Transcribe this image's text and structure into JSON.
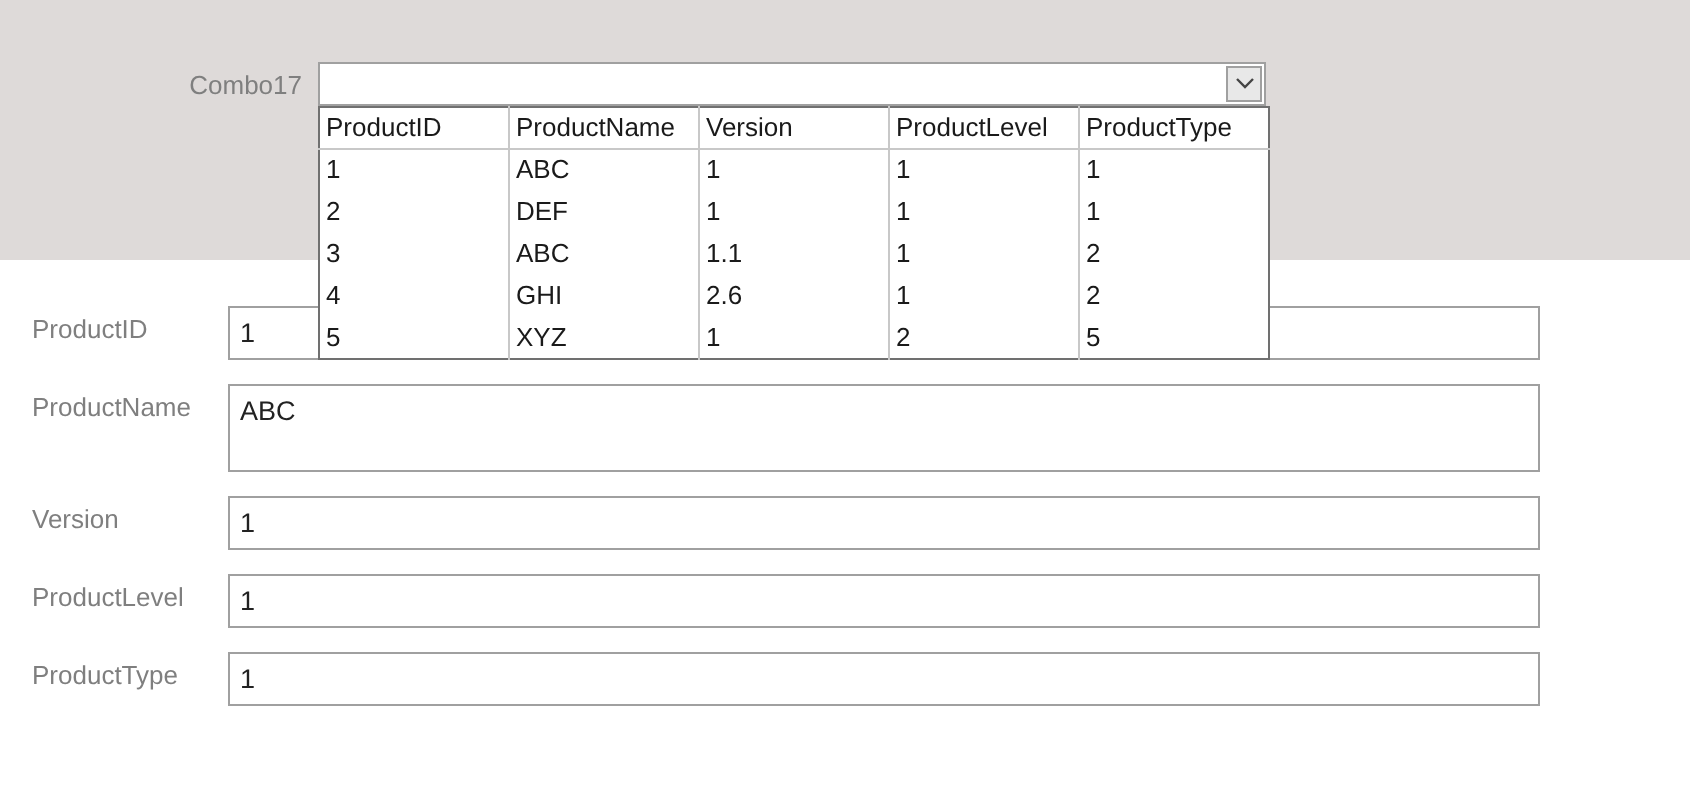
{
  "header": {
    "combo": {
      "label": "Combo17",
      "dropdown": {
        "columns": [
          "ProductID",
          "ProductName",
          "Version",
          "ProductLevel",
          "ProductType"
        ],
        "rows": [
          [
            "1",
            "ABC",
            "1",
            "1",
            "1"
          ],
          [
            "2",
            "DEF",
            "1",
            "1",
            "1"
          ],
          [
            "3",
            "ABC",
            "1.1",
            "1",
            "2"
          ],
          [
            "4",
            "GHI",
            "2.6",
            "1",
            "2"
          ],
          [
            "5",
            "XYZ",
            "1",
            "2",
            "5"
          ]
        ]
      }
    }
  },
  "fields": [
    {
      "label": "ProductID",
      "value": "1",
      "kind": "text"
    },
    {
      "label": "ProductName",
      "value": "ABC",
      "kind": "memo"
    },
    {
      "label": "Version",
      "value": "1",
      "kind": "text"
    },
    {
      "label": "ProductLevel",
      "value": "1",
      "kind": "text"
    },
    {
      "label": "ProductType",
      "value": "1",
      "kind": "text"
    }
  ]
}
